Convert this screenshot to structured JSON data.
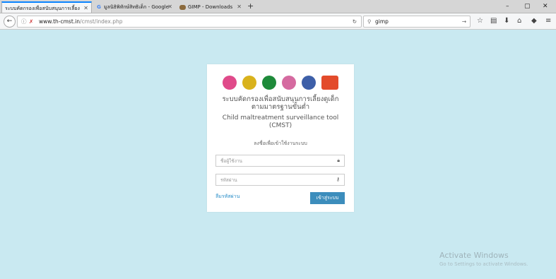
{
  "tabs": [
    {
      "title": "ระบบคัดกรองเพื่อสนับสนุนการเลี้ยง",
      "active": true
    },
    {
      "title": "มูลนิธิพิทักษ์สิทธิเด็ก - Google",
      "active": false
    },
    {
      "title": "GIMP - Downloads",
      "active": false
    }
  ],
  "window_controls": {
    "minimize": "–",
    "maximize": "▢",
    "close": "✕"
  },
  "nav": {
    "back_icon": "←",
    "url_domain": "www.th-cmst.in",
    "url_path": "/cmst/index.php",
    "reload_icon": "↻",
    "search_value": "gimp",
    "search_icon": "⚲",
    "go_icon": "→"
  },
  "toolbar": {
    "star": "☆",
    "library": "▤",
    "download": "⬇",
    "home": "⌂",
    "pocket": "◆",
    "menu": "≡"
  },
  "login": {
    "title_line1": "ระบบคัดกรองเพื่อสนับสนุนการเลี้ยงดูเด็ก",
    "title_line2": "ตามมาตรฐานขั้นต่ำ",
    "subtitle_line1": "Child maltreatment surveillance tool",
    "subtitle_line2": "(CMST)",
    "prompt": "ลงชื่อเพื่อเข้าใช้งานระบบ",
    "username_placeholder": "ชื่อผู้ใช้งาน",
    "password_placeholder": "รหัสผ่าน",
    "forgot_label": "ลืมรหัสผ่าน",
    "login_label": "เข้าสู่ระบบ"
  },
  "logos": [
    {
      "name": "ministry-seal-logo",
      "color": "#e04a8a"
    },
    {
      "name": "royal-emblem-logo",
      "color": "#d9b21c"
    },
    {
      "name": "public-health-logo",
      "color": "#1e8a3a"
    },
    {
      "name": "pink-seal-logo",
      "color": "#d56aa0"
    },
    {
      "name": "blue-university-logo",
      "color": "#3d5fa8"
    },
    {
      "name": "foundation-logo",
      "color": "#e34b2b"
    }
  ],
  "watermark": {
    "line1": "Activate Windows",
    "line2": "Go to Settings to activate Windows."
  },
  "colors": {
    "background": "#c9e9f1",
    "accent": "#3c8dbc",
    "link": "#2a8ec8"
  }
}
